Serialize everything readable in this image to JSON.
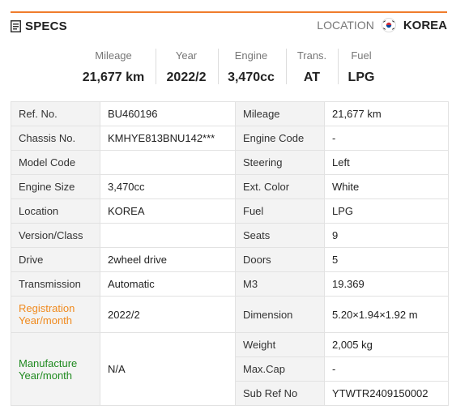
{
  "header": {
    "specs_label": "SPECS",
    "location_label": "LOCATION",
    "location_value": "KOREA"
  },
  "summary": [
    {
      "label": "Mileage",
      "value": "21,677 km"
    },
    {
      "label": "Year",
      "value": "2022/2"
    },
    {
      "label": "Engine",
      "value": "3,470cc"
    },
    {
      "label": "Trans.",
      "value": "AT"
    },
    {
      "label": "Fuel",
      "value": "LPG"
    }
  ],
  "left": [
    {
      "key": "Ref. No.",
      "value": "BU460196"
    },
    {
      "key": "Chassis No.",
      "value": "KMHYE813BNU142***"
    },
    {
      "key": "Model Code",
      "value": ""
    },
    {
      "key": "Engine Size",
      "value": "3,470cc"
    },
    {
      "key": "Location",
      "value": "KOREA"
    },
    {
      "key": "Version/Class",
      "value": ""
    },
    {
      "key": "Drive",
      "value": "2wheel drive"
    },
    {
      "key": "Transmission",
      "value": "Automatic"
    },
    {
      "key": "Registration Year/month",
      "value": "2022/2"
    },
    {
      "key": "Manufacture Year/month",
      "value": "N/A"
    }
  ],
  "right": [
    {
      "key": "Mileage",
      "value": "21,677 km"
    },
    {
      "key": "Engine Code",
      "value": "-"
    },
    {
      "key": "Steering",
      "value": "Left"
    },
    {
      "key": "Ext. Color",
      "value": "White"
    },
    {
      "key": "Fuel",
      "value": "LPG"
    },
    {
      "key": "Seats",
      "value": "9"
    },
    {
      "key": "Doors",
      "value": "5"
    },
    {
      "key": "M3",
      "value": "19.369"
    },
    {
      "key": "Dimension",
      "value": "5.20×1.94×1.92 m"
    },
    {
      "key": "Weight",
      "value": "2,005 kg"
    },
    {
      "key": "Max.Cap",
      "value": "-"
    },
    {
      "key": "Sub Ref No",
      "value": "YTWTR2409150002"
    }
  ],
  "colors": {
    "accent": "#f07c2c",
    "registration_label": "#f08a1e",
    "manufacture_label": "#1f8a1f"
  },
  "icons": {
    "specs": "document-icon",
    "location": "south-korea-flag-icon"
  }
}
